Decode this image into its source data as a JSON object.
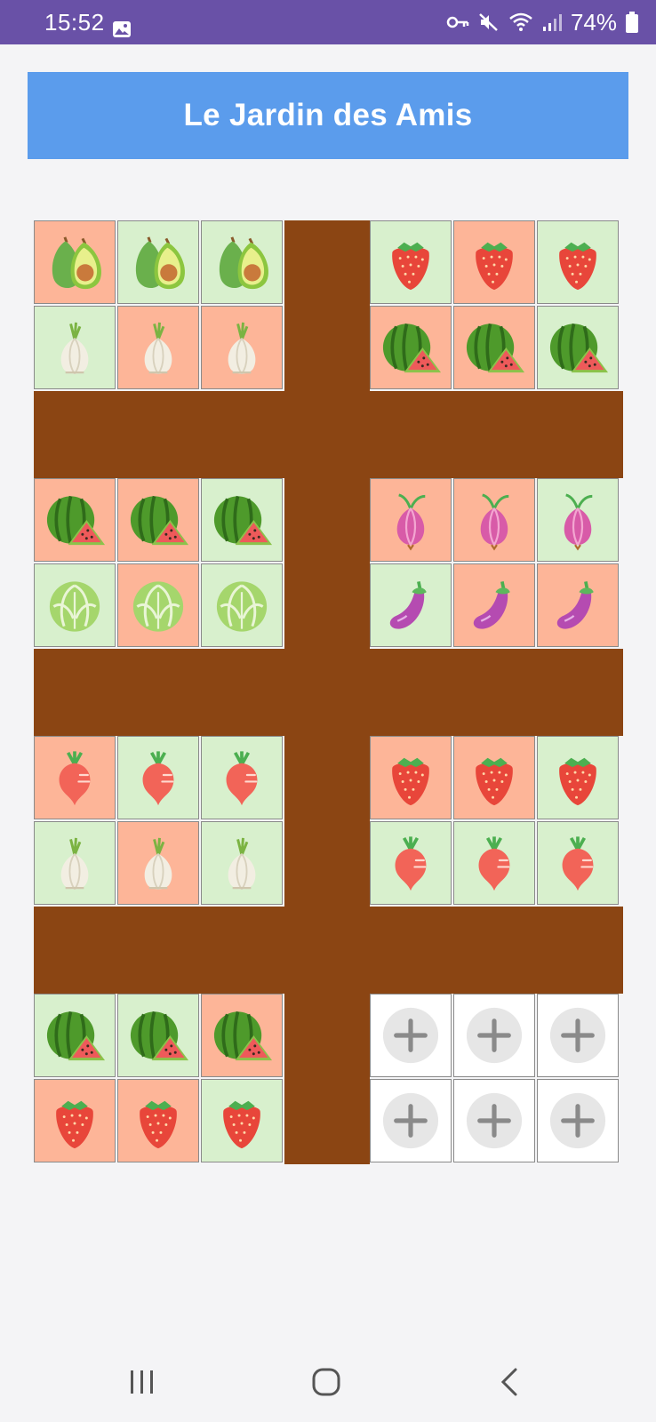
{
  "status_bar": {
    "time": "15:52",
    "battery": "74%",
    "background_color": "#6951a7",
    "icons": [
      "gallery-icon",
      "key-icon",
      "mute-icon",
      "wifi-icon",
      "signal-icon",
      "battery-icon"
    ]
  },
  "header": {
    "title": "Le Jardin des Amis",
    "background_color": "#5b9cec"
  },
  "garden": {
    "path_color": "#8b4513",
    "tile_colors": {
      "green": "#d8f0cd",
      "salmon": "#fdb598",
      "empty": "#ffffff"
    },
    "plots": [
      {
        "name": "plot-1",
        "rows": [
          [
            {
              "plant": "avocado",
              "bg": "salmon"
            },
            {
              "plant": "avocado",
              "bg": "green"
            },
            {
              "plant": "avocado",
              "bg": "green"
            }
          ],
          [
            {
              "plant": "garlic",
              "bg": "green"
            },
            {
              "plant": "garlic",
              "bg": "salmon"
            },
            {
              "plant": "garlic",
              "bg": "salmon"
            }
          ]
        ]
      },
      {
        "name": "plot-2",
        "rows": [
          [
            {
              "plant": "strawberry",
              "bg": "green"
            },
            {
              "plant": "strawberry",
              "bg": "salmon"
            },
            {
              "plant": "strawberry",
              "bg": "green"
            }
          ],
          [
            {
              "plant": "watermelon",
              "bg": "salmon"
            },
            {
              "plant": "watermelon",
              "bg": "salmon"
            },
            {
              "plant": "watermelon",
              "bg": "green"
            }
          ]
        ]
      },
      {
        "name": "plot-3",
        "rows": [
          [
            {
              "plant": "watermelon",
              "bg": "salmon"
            },
            {
              "plant": "watermelon",
              "bg": "salmon"
            },
            {
              "plant": "watermelon",
              "bg": "green"
            }
          ],
          [
            {
              "plant": "cabbage",
              "bg": "green"
            },
            {
              "plant": "cabbage",
              "bg": "salmon"
            },
            {
              "plant": "cabbage",
              "bg": "green"
            }
          ]
        ]
      },
      {
        "name": "plot-4",
        "rows": [
          [
            {
              "plant": "onion",
              "bg": "salmon"
            },
            {
              "plant": "onion",
              "bg": "salmon"
            },
            {
              "plant": "onion",
              "bg": "green"
            }
          ],
          [
            {
              "plant": "eggplant",
              "bg": "green"
            },
            {
              "plant": "eggplant",
              "bg": "salmon"
            },
            {
              "plant": "eggplant",
              "bg": "salmon"
            }
          ]
        ]
      },
      {
        "name": "plot-5",
        "rows": [
          [
            {
              "plant": "radish",
              "bg": "salmon"
            },
            {
              "plant": "radish",
              "bg": "green"
            },
            {
              "plant": "radish",
              "bg": "green"
            }
          ],
          [
            {
              "plant": "garlic",
              "bg": "green"
            },
            {
              "plant": "garlic",
              "bg": "salmon"
            },
            {
              "plant": "garlic",
              "bg": "green"
            }
          ]
        ]
      },
      {
        "name": "plot-6",
        "rows": [
          [
            {
              "plant": "strawberry",
              "bg": "salmon"
            },
            {
              "plant": "strawberry",
              "bg": "salmon"
            },
            {
              "plant": "strawberry",
              "bg": "green"
            }
          ],
          [
            {
              "plant": "radish",
              "bg": "green"
            },
            {
              "plant": "radish",
              "bg": "green"
            },
            {
              "plant": "radish",
              "bg": "green"
            }
          ]
        ]
      },
      {
        "name": "plot-7",
        "rows": [
          [
            {
              "plant": "watermelon",
              "bg": "green"
            },
            {
              "plant": "watermelon",
              "bg": "green"
            },
            {
              "plant": "watermelon",
              "bg": "salmon"
            }
          ],
          [
            {
              "plant": "strawberry",
              "bg": "salmon"
            },
            {
              "plant": "strawberry",
              "bg": "salmon"
            },
            {
              "plant": "strawberry",
              "bg": "green"
            }
          ]
        ]
      },
      {
        "name": "plot-8",
        "rows": [
          [
            {
              "plant": "add",
              "bg": "empty"
            },
            {
              "plant": "add",
              "bg": "empty"
            },
            {
              "plant": "add",
              "bg": "empty"
            }
          ],
          [
            {
              "plant": "add",
              "bg": "empty"
            },
            {
              "plant": "add",
              "bg": "empty"
            },
            {
              "plant": "add",
              "bg": "empty"
            }
          ]
        ]
      }
    ]
  },
  "nav_bar": {
    "buttons": [
      "recent-apps-button",
      "home-button",
      "back-button"
    ]
  }
}
